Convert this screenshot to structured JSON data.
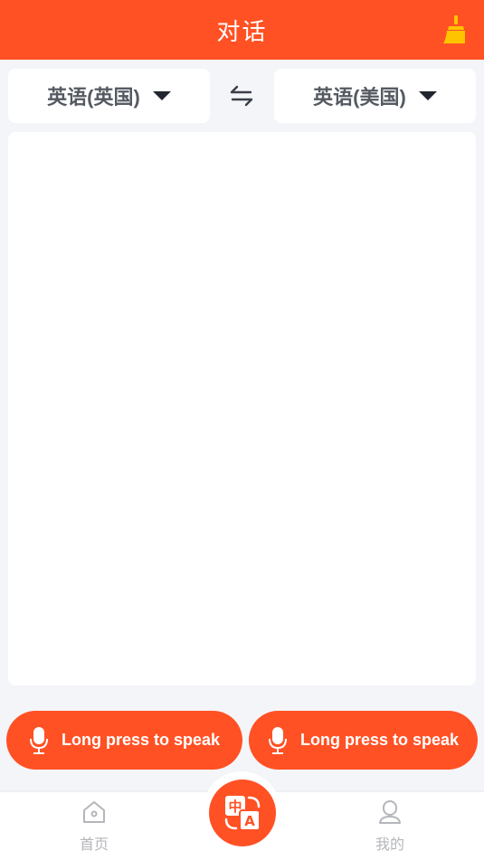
{
  "header": {
    "title": "对话",
    "clear_icon": "broom-icon"
  },
  "languages": {
    "source": "英语(英国)",
    "target": "英语(美国)",
    "swap_icon": "swap-arrows-icon"
  },
  "speak_buttons": {
    "left_label": "Long press to speak",
    "right_label": "Long press to speak",
    "icon": "microphone-icon"
  },
  "tabbar": {
    "home_label": "首页",
    "center_icon": "translate-icon",
    "mine_label": "我的"
  },
  "colors": {
    "accent": "#ff5124",
    "broom": "#ffc400",
    "background": "#f4f5f9"
  }
}
